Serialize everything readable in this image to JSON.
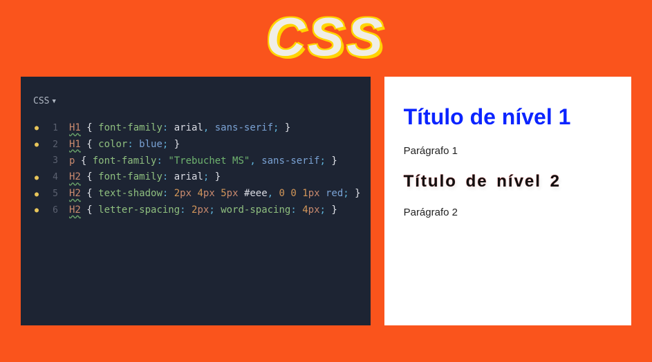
{
  "title": "CSS",
  "editor": {
    "lang_label": "CSS",
    "lines": [
      {
        "n": "1",
        "dot": true,
        "tokens": [
          [
            "sel",
            "H1"
          ],
          [
            "brace",
            " { "
          ],
          [
            "prop",
            "font-family"
          ],
          [
            "punc",
            ": "
          ],
          [
            "val",
            "arial"
          ],
          [
            "punc",
            ", "
          ],
          [
            "kw",
            "sans-serif"
          ],
          [
            "punc",
            "; "
          ],
          [
            "brace",
            "}"
          ]
        ]
      },
      {
        "n": "2",
        "dot": true,
        "tokens": [
          [
            "sel",
            "H1"
          ],
          [
            "brace",
            " { "
          ],
          [
            "prop",
            "color"
          ],
          [
            "punc",
            ": "
          ],
          [
            "kw",
            "blue"
          ],
          [
            "punc",
            "; "
          ],
          [
            "brace",
            "}"
          ]
        ]
      },
      {
        "n": "3",
        "dot": false,
        "tokens": [
          [
            "sel2",
            "p"
          ],
          [
            "brace",
            " { "
          ],
          [
            "prop",
            "font-family"
          ],
          [
            "punc",
            ": "
          ],
          [
            "str",
            "\"Trebuchet MS\""
          ],
          [
            "punc",
            ", "
          ],
          [
            "kw",
            "sans-serif"
          ],
          [
            "punc",
            "; "
          ],
          [
            "brace",
            "}"
          ]
        ]
      },
      {
        "n": "4",
        "dot": true,
        "tokens": [
          [
            "sel",
            "H2"
          ],
          [
            "brace",
            " { "
          ],
          [
            "prop",
            "font-family"
          ],
          [
            "punc",
            ": "
          ],
          [
            "val",
            "arial"
          ],
          [
            "punc",
            "; "
          ],
          [
            "brace",
            "}"
          ]
        ]
      },
      {
        "n": "5",
        "dot": true,
        "tokens": [
          [
            "sel",
            "H2"
          ],
          [
            "brace",
            " { "
          ],
          [
            "prop",
            "text-shadow"
          ],
          [
            "punc",
            ": "
          ],
          [
            "num",
            "2"
          ],
          [
            "unit",
            "px "
          ],
          [
            "num",
            "4"
          ],
          [
            "unit",
            "px "
          ],
          [
            "num",
            "5"
          ],
          [
            "unit",
            "px "
          ],
          [
            "hex",
            "#eee"
          ],
          [
            "punc",
            ", "
          ],
          [
            "num",
            "0"
          ],
          [
            "val",
            " "
          ],
          [
            "num",
            "0"
          ],
          [
            "val",
            " "
          ],
          [
            "num",
            "1"
          ],
          [
            "unit",
            "px "
          ],
          [
            "kw",
            "red"
          ],
          [
            "punc",
            "; "
          ],
          [
            "brace",
            "}"
          ]
        ]
      },
      {
        "n": "6",
        "dot": true,
        "tokens": [
          [
            "sel",
            "H2"
          ],
          [
            "brace",
            " { "
          ],
          [
            "prop",
            "letter-spacing"
          ],
          [
            "punc",
            ": "
          ],
          [
            "num",
            "2"
          ],
          [
            "unit",
            "px"
          ],
          [
            "punc",
            "; "
          ],
          [
            "prop",
            "word-spacing"
          ],
          [
            "punc",
            ": "
          ],
          [
            "num",
            "4"
          ],
          [
            "unit",
            "px"
          ],
          [
            "punc",
            "; "
          ],
          [
            "brace",
            "}"
          ]
        ]
      }
    ]
  },
  "preview": {
    "h1": "Título de nível 1",
    "p1": "Parágrafo 1",
    "h2": "Título de nível 2",
    "p2": "Parágrafo 2"
  }
}
